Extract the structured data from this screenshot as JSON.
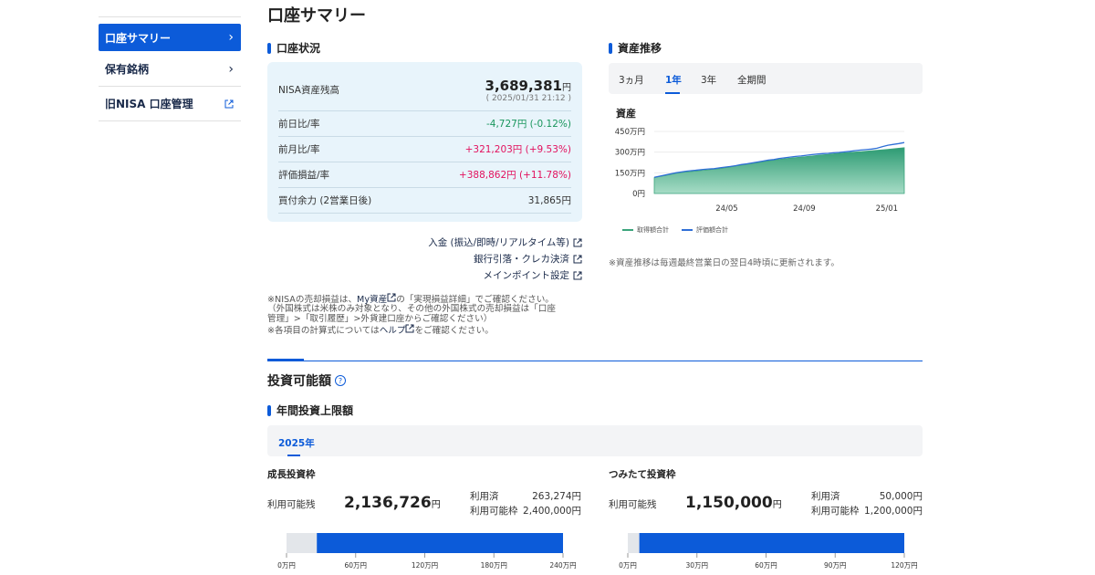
{
  "sidebar": {
    "items": [
      {
        "label": "口座サマリー",
        "icon": "chevron-right-icon"
      },
      {
        "label": "保有銘柄",
        "icon": "chevron-right-icon"
      },
      {
        "label": "旧NISA 口座管理",
        "icon": "external-link-icon"
      }
    ]
  },
  "page_title": "口座サマリー",
  "account": {
    "heading": "口座状況",
    "balance_label": "NISA資産残高",
    "balance_value": "3,689,381",
    "yen": "円",
    "timestamp": "( 2025/01/31 21:12 )",
    "rows": [
      {
        "label": "前日比/率",
        "value": "-4,727円 (-0.12%)"
      },
      {
        "label": "前月比/率",
        "value": "+321,203円 (+9.53%)"
      },
      {
        "label": "評価損益/率",
        "value": "+388,862円 (+11.78%)"
      },
      {
        "label": "買付余力 (2営業日後)",
        "value": "31,865円"
      }
    ],
    "links": [
      "入金 (振込/即時/リアルタイム等)",
      "銀行引落・クレカ決済",
      "メインポイント設定"
    ],
    "notes": {
      "line1_a": "※NISAの売却損益は、",
      "line1_link": "My資産",
      "line1_b": "の「実現損益詳細」でご確認ください。",
      "line2": "（外国株式は米株のみ対象となり、その他の外国株式の売却損益は「口座",
      "line3": "管理」>「取引履歴」>外貨建口座からご確認ください）",
      "line4_a": "※各項目の計算式については",
      "line4_link": "ヘルプ",
      "line4_b": "をご確認ください。"
    }
  },
  "trend": {
    "heading": "資産推移",
    "tabs": [
      "3ヵ月",
      "1年",
      "3年",
      "全期間"
    ],
    "active_tab": "1年",
    "chart_title": "資産",
    "note": "※資産推移は毎週最終営業日の翌日4時頃に更新されます。"
  },
  "chart_data": {
    "type": "area",
    "title": "資産",
    "y_ticks": [
      "450万円",
      "300万円",
      "150万円",
      "0円"
    ],
    "x_ticks": [
      "24/05",
      "24/09",
      "25/01"
    ],
    "ylim": [
      0,
      4500000
    ],
    "series": [
      {
        "name": "取得額合計",
        "color": "#3aa47c",
        "values": [
          1150000,
          1230000,
          1300000,
          1380000,
          1460000,
          1520000,
          1560000,
          1600000,
          1640000,
          1680000,
          1720000,
          1760000,
          1800000,
          1860000,
          1920000,
          1990000,
          2060000,
          2120000,
          2180000,
          2240000,
          2300000,
          2360000,
          2420000,
          2470000,
          2520000,
          2560000,
          2600000,
          2640000,
          2680000,
          2720000,
          2760000,
          2800000,
          2840000,
          2880000,
          2920000,
          2950000,
          2980000,
          3010000,
          3040000,
          3070000,
          3100000,
          3130000,
          3160000,
          3200000,
          3240000,
          3280000,
          3320000
        ]
      },
      {
        "name": "評価額合計",
        "color": "#2f6fd6",
        "values": [
          1180000,
          1260000,
          1340000,
          1420000,
          1500000,
          1560000,
          1620000,
          1660000,
          1700000,
          1750000,
          1780000,
          1800000,
          1860000,
          1910000,
          1960000,
          2020000,
          2100000,
          2150000,
          2220000,
          2280000,
          2350000,
          2420000,
          2460000,
          2540000,
          2590000,
          2640000,
          2690000,
          2720000,
          2770000,
          2820000,
          2860000,
          2890000,
          2910000,
          2950000,
          2980000,
          3020000,
          3060000,
          3110000,
          3150000,
          3180000,
          3220000,
          3280000,
          3400000,
          3500000,
          3560000,
          3620000,
          3689381
        ]
      }
    ],
    "grid": true
  },
  "invest": {
    "title": "投資可能額",
    "sub_heading": "年間投資上限額",
    "year_tab": "2025年",
    "growth": {
      "title": "成長投資枠",
      "avail_label": "利用可能残",
      "avail_value": "2,136,726",
      "used_label": "利用済",
      "used_value": "263,274円",
      "limit_label": "利用可能枠",
      "limit_value": "2,400,000円",
      "used_fraction": 0.1097,
      "ticks": [
        "0万円",
        "60万円",
        "120万円",
        "180万円",
        "240万円"
      ]
    },
    "tsumitate": {
      "title": "つみたて投資枠",
      "avail_label": "利用可能残",
      "avail_value": "1,150,000",
      "used_label": "利用済",
      "used_value": "50,000円",
      "limit_label": "利用可能枠",
      "limit_value": "1,200,000円",
      "used_fraction": 0.0417,
      "ticks": [
        "0万円",
        "30万円",
        "60万円",
        "90万円",
        "120万円"
      ]
    },
    "yen": "円"
  },
  "colors": {
    "accent": "#0c5bd9",
    "positive": "#e2115e",
    "negative": "#18955c",
    "panel": "#e8f4fb"
  }
}
